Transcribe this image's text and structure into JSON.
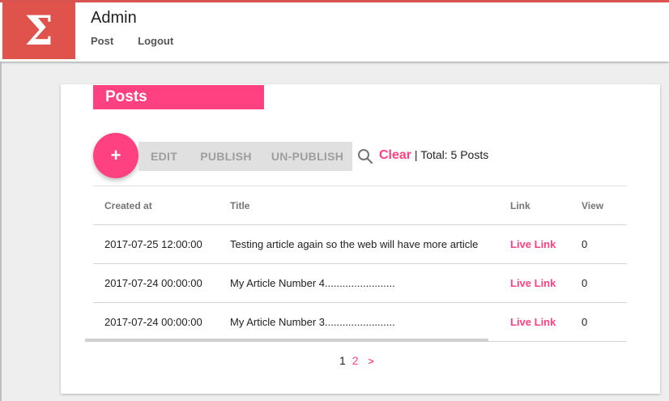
{
  "header": {
    "logo_glyph": "Σ",
    "title": "Admin",
    "nav": [
      "Post",
      "Logout"
    ]
  },
  "card": {
    "title": "Posts",
    "add_label": "+",
    "toolbar": {
      "edit": "EDIT",
      "publish": "PUBLISH",
      "unpublish": "UN-PUBLISH",
      "search_icon": "search-icon",
      "clear": "Clear",
      "total": "| Total: 5 Posts"
    },
    "table": {
      "columns": [
        "Created at",
        "Title",
        "Link",
        "View"
      ],
      "rows": [
        {
          "created": "2017-07-25 12:00:00",
          "title": "Testing article again so the web will have more article",
          "link": "Live Link",
          "views": "0"
        },
        {
          "created": "2017-07-24 00:00:00",
          "title": "My Article Number 4........................",
          "link": "Live Link",
          "views": "0"
        },
        {
          "created": "2017-07-24 00:00:00",
          "title": "My Article Number 3........................",
          "link": "Live Link",
          "views": "0"
        }
      ]
    },
    "pagination": {
      "current": "1",
      "next_page": "2",
      "next": ">"
    }
  },
  "colors": {
    "accent": "#ff4081",
    "brand": "#e0524c"
  }
}
